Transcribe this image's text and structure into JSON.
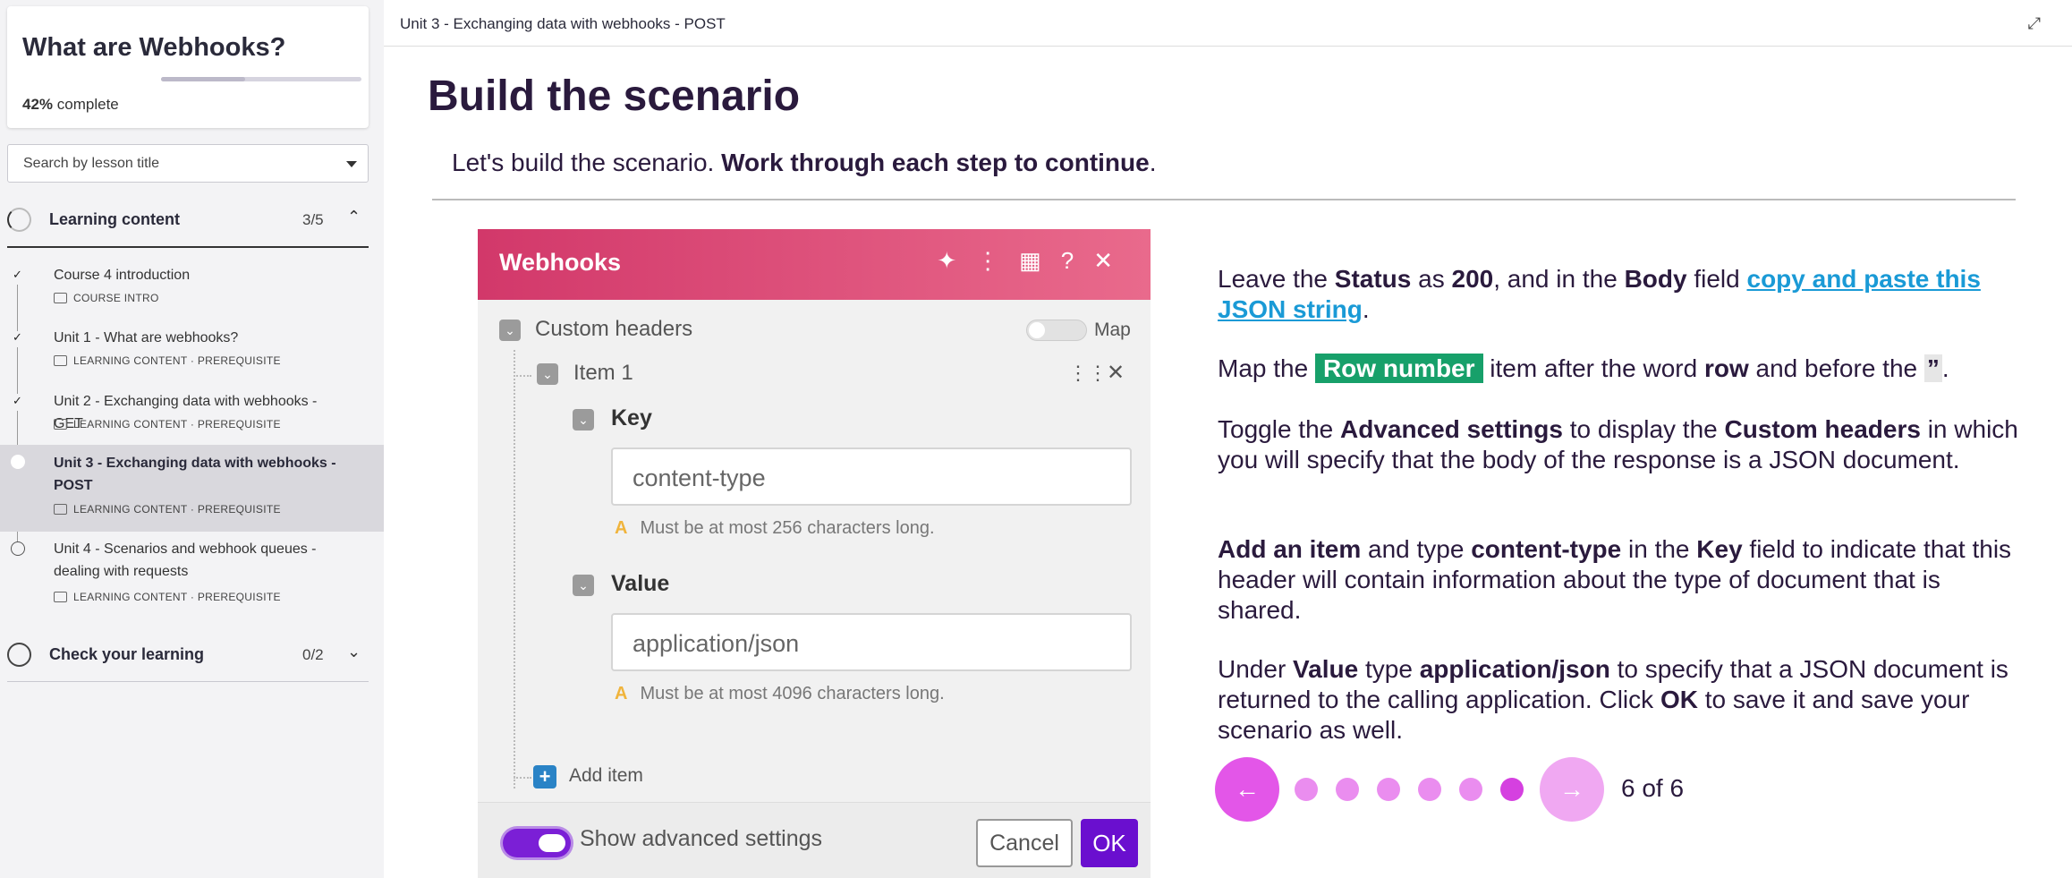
{
  "sidebar": {
    "course_title": "What are Webhooks?",
    "progress_percent": "42%",
    "progress_label": "complete",
    "progress_fraction": 0.42,
    "search_placeholder": "Search by lesson title",
    "sections": [
      {
        "label": "Learning content",
        "count": "3/5",
        "lessons": [
          {
            "title": "Course 4 introduction",
            "meta": "COURSE INTRO",
            "done": true
          },
          {
            "title": "Unit 1 - What are webhooks?",
            "meta": "LEARNING CONTENT · PREREQUISITE",
            "done": true
          },
          {
            "title": "Unit 2 - Exchanging data with webhooks - GET",
            "meta": "LEARNING CONTENT · PREREQUISITE",
            "done": true
          },
          {
            "title": "Unit 3 - Exchanging data with webhooks - POST",
            "meta": "LEARNING CONTENT · PREREQUISITE",
            "done": false
          },
          {
            "title": "Unit 4 - Scenarios and webhook queues - dealing with requests",
            "meta": "LEARNING CONTENT · PREREQUISITE",
            "done": false
          }
        ]
      },
      {
        "label": "Check your learning",
        "count": "0/2"
      }
    ]
  },
  "main": {
    "unit_title": "Unit 3 - Exchanging data with webhooks - POST",
    "heading": "Build the scenario",
    "intro_plain": "Let's build the scenario.",
    "intro_bold": "Work through each step to continue",
    "intro_end": "."
  },
  "dialog": {
    "title": "Webhooks",
    "custom_headers": "Custom headers",
    "map_label": "Map",
    "item_label": "Item 1",
    "key_label": "Key",
    "key_value": "content-type",
    "key_warning": "Must be at most 256 characters long.",
    "value_label": "Value",
    "value_value": "application/json",
    "value_warning": "Must be at most 4096 characters long.",
    "add_item": "Add item",
    "show_advanced": "Show advanced settings",
    "cancel": "Cancel",
    "ok": "OK"
  },
  "instructions": {
    "p1": {
      "a": "Leave the ",
      "b1": "Status",
      "c": " as ",
      "b2": "200",
      "d": ", and in the ",
      "b3": "Body",
      "e": " field ",
      "link": "copy and paste this JSON string",
      "f": "."
    },
    "p2": {
      "a": "Map the ",
      "pill": "Row number",
      "b": " item after the word ",
      "b1": "row",
      "c": " and before the ",
      "quote": "”",
      "d": "."
    },
    "p3": {
      "a": "Toggle the ",
      "b1": "Advanced settings",
      "b": " to display the ",
      "b2": "Custom headers",
      "c": " in which you will specify that the body of the response is a JSON document."
    },
    "p4": {
      "b1": "Add an item",
      "a": " and type ",
      "b2": "content-type",
      "b": " in the ",
      "b3": "Key",
      "c": " field to indicate that this header will contain information about the type of document that is shared."
    },
    "p5": {
      "a": "Under ",
      "b1": "Value",
      "b": " type ",
      "b2": "application/json",
      "c": " to specify that a JSON document is returned to the calling application. Click ",
      "b3": "OK",
      "d": " to save it and save your scenario as well."
    }
  },
  "stepper": {
    "current": 6,
    "total": 6,
    "counter": "6 of 6"
  },
  "colors": {
    "accent": "#e356e8",
    "dialog_header": "#d2386a",
    "ok_button": "#6a0fcf",
    "link": "#1a9ad6",
    "pill": "#17a06a"
  }
}
